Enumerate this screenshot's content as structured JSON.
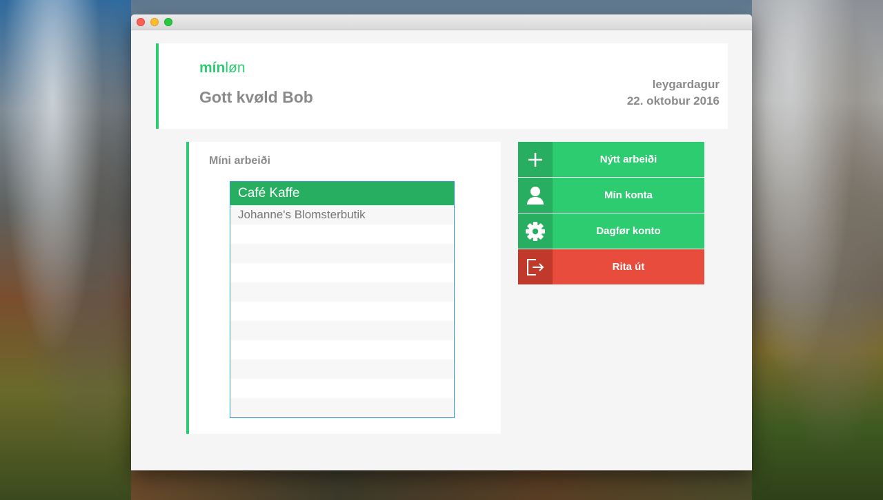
{
  "colors": {
    "accent": "#2ecc71",
    "accent_dark": "#27ae60",
    "danger": "#e74c3c",
    "danger_dark": "#c0392b",
    "text_muted": "#8a8a8a",
    "list_border": "#2e9ed6"
  },
  "header": {
    "logo_bold": "mín",
    "logo_light": "løn",
    "greeting": "Gott kvøld Bob",
    "weekday": "leygardagur",
    "date": "22. oktobur 2016"
  },
  "work": {
    "title": "Míni arbeiði",
    "items": [
      {
        "label": "Café Kaffe",
        "selected": true
      },
      {
        "label": "Johanne's Blomsterbutik",
        "selected": false
      }
    ]
  },
  "actions": [
    {
      "label": "Nýtt arbeiði",
      "icon": "plus-icon"
    },
    {
      "label": "Mín konta",
      "icon": "user-icon"
    },
    {
      "label": "Dagfør konto",
      "icon": "gear-icon"
    },
    {
      "label": "Rita út",
      "icon": "logout-icon"
    }
  ]
}
